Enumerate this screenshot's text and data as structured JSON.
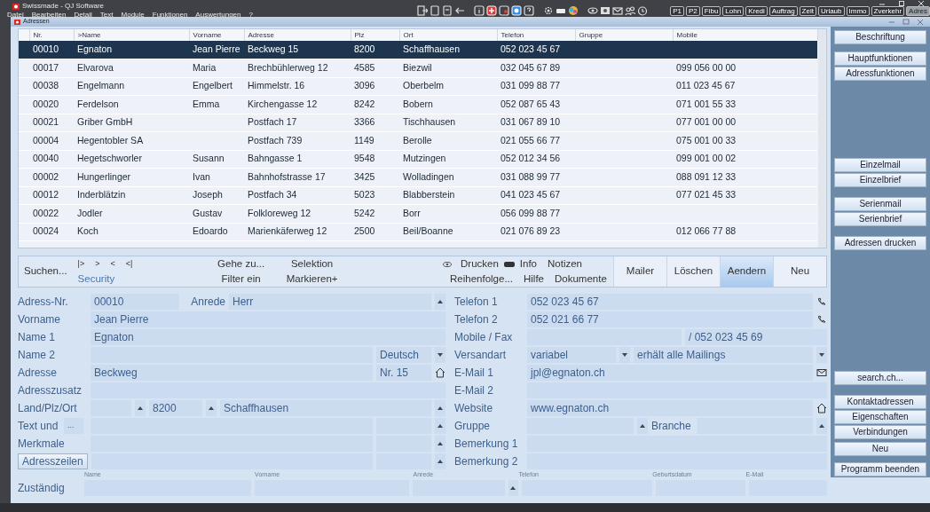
{
  "window": {
    "title": "Swissmade - QJ Software"
  },
  "menu": [
    "Datei",
    "Bearbeiten",
    "Detail",
    "Text",
    "Module",
    "Funktionen",
    "Auswertungen",
    "?"
  ],
  "modules": [
    {
      "label": "P1",
      "selected": false
    },
    {
      "label": "P2",
      "selected": false
    },
    {
      "label": "Fibu",
      "selected": false
    },
    {
      "label": "Lohn",
      "selected": false
    },
    {
      "label": "Kredi",
      "selected": false
    },
    {
      "label": "Auftrag",
      "selected": false
    },
    {
      "label": "Zeit",
      "selected": false
    },
    {
      "label": "Urlaub",
      "selected": false
    },
    {
      "label": "Immo",
      "selected": false
    },
    {
      "label": "Zverkehr",
      "selected": false
    },
    {
      "label": "Adres",
      "selected": true
    }
  ],
  "child_window": {
    "title": "Adressen"
  },
  "table": {
    "columns": [
      "Nr.",
      ">Name",
      "Vorname",
      "Adresse",
      "Plz",
      "Ort",
      "Telefon",
      "Gruppe",
      "Mobile"
    ],
    "rows": [
      {
        "selected": true,
        "cells": [
          "00010",
          "Egnaton",
          "Jean Pierre",
          "Beckweg 15",
          "8200",
          "Schaffhausen",
          "052 023 45 67",
          null,
          null
        ]
      },
      {
        "selected": false,
        "cells": [
          "00017",
          "Elvarova",
          "Maria",
          "Brechbühlerweg 12",
          "4585",
          "Biezwil",
          "032 045 67 89",
          null,
          "099 056 00 00"
        ]
      },
      {
        "selected": false,
        "cells": [
          "00038",
          "Engelmann",
          "Engelbert",
          "Himmelstr. 16",
          "3096",
          "Oberbelm",
          "031 099 88 77",
          null,
          "011 023 45 67"
        ]
      },
      {
        "selected": false,
        "cells": [
          "00020",
          "Ferdelson",
          "Emma",
          "Kirchengasse 12",
          "8242",
          "Bobern",
          "052 087 65 43",
          null,
          "071 001 55 33"
        ]
      },
      {
        "selected": false,
        "cells": [
          "00021",
          "Griber GmbH",
          null,
          "Postfach 17",
          "3366",
          "Tischhausen",
          "031 067 89 10",
          null,
          "077 001 00 00"
        ]
      },
      {
        "selected": false,
        "cells": [
          "00004",
          "Hegentobler SA",
          null,
          "Postfach 739",
          "1149",
          "Berolle",
          "021 055 66 77",
          null,
          "075 001 00 33"
        ]
      },
      {
        "selected": false,
        "cells": [
          "00040",
          "Hegetschworler",
          "Susann",
          "Bahngasse 1",
          "9548",
          "Mutzingen",
          "052 012 34 56",
          null,
          "099 001 00 02"
        ]
      },
      {
        "selected": false,
        "cells": [
          "00002",
          "Hungerlinger",
          "Ivan",
          "Bahnhofstrasse 17",
          "3425",
          "Wolladingen",
          "031 088 99 77",
          null,
          "088 091 12 33"
        ]
      },
      {
        "selected": false,
        "cells": [
          "00012",
          "Inderblätzin",
          "Joseph",
          "Postfach 34",
          "5023",
          "Blabberstein",
          "041 023 45 67",
          null,
          "077 021 45 33"
        ]
      },
      {
        "selected": false,
        "cells": [
          "00022",
          "Jodler",
          "Gustav",
          "Folkloreweg 12",
          "5242",
          "Borr",
          "056 099 88 77",
          null,
          null
        ]
      },
      {
        "selected": false,
        "cells": [
          "00024",
          "Koch",
          "Edoardo",
          "Marienkäferweg 12",
          "2500",
          "Beil/Boanne",
          "021 076 89 23",
          null,
          "012 066 77 88"
        ]
      }
    ]
  },
  "side_buttons": [
    [
      "Beschriftung"
    ],
    [
      "Hauptfunktionen",
      "Adressfunktionen"
    ],
    [
      "Einzelmail",
      "Einzelbrief"
    ],
    [
      "Serienmail",
      "Serienbrief"
    ],
    [
      "Adressen drucken"
    ],
    [
      "search.ch..."
    ],
    [
      "Kontaktadressen",
      "Eigenschaften",
      "Verbindungen"
    ],
    [
      "Neu"
    ],
    [
      "Programm beenden"
    ]
  ],
  "toolbar": {
    "search": "Suchen...",
    "nav": [
      "|>",
      ">",
      "<",
      "<|"
    ],
    "security": "Security",
    "goto": "Gehe zu...",
    "filter": "Filter ein",
    "selection": "Selektion",
    "mark": "Markieren+",
    "print": "Drucken",
    "info": "Info",
    "notes": "Notizen",
    "order": "Reihenfolge...",
    "help": "Hilfe",
    "documents": "Dokumente",
    "actions": [
      {
        "label": "Mailer",
        "selected": false
      },
      {
        "label": "Löschen",
        "selected": false
      },
      {
        "label": "Aendern",
        "selected": true
      },
      {
        "label": "Neu",
        "selected": false
      }
    ]
  },
  "form": {
    "left": [
      {
        "label": "Adress-Nr.",
        "value": "00010",
        "label2": "Anrede",
        "value2": "Herr"
      },
      {
        "label": "Vorname",
        "value": "Jean Pierre"
      },
      {
        "label": "Name 1",
        "value": "Egnaton"
      },
      {
        "label": "Name 2",
        "value2": "Deutsch"
      },
      {
        "label": "Adresse",
        "value": "Beckweg",
        "value2": "Nr. 15"
      },
      {
        "label": "Adresszusatz"
      },
      {
        "label": "Land/Plz/Ort",
        "value2": "8200",
        "value3": "Schaffhausen"
      },
      {
        "label": "Text und",
        "button": "..."
      },
      {
        "label": "Merkmale"
      }
    ],
    "address_lines_button": "Adresszeilen",
    "right": [
      {
        "label": "Telefon 1",
        "value": "052 023 45 67"
      },
      {
        "label": "Telefon 2",
        "value": "052 021 66 77"
      },
      {
        "label": "Mobile / Fax",
        "value2": "/ 052 023 45 69"
      },
      {
        "label": "Versandart",
        "value": "variabel",
        "value2": "erhält alle Mailings"
      },
      {
        "label": "E-Mail 1",
        "value": "jpl@egnaton.ch"
      },
      {
        "label": "E-Mail 2"
      },
      {
        "label": "Website",
        "value": "www.egnaton.ch"
      },
      {
        "label": "Gruppe",
        "label2": "Branche"
      },
      {
        "label": "Bemerkung 1"
      },
      {
        "label": "Bemerkung 2"
      }
    ],
    "responsible": {
      "label": "Zuständig",
      "columns": [
        "Name",
        "Vorname",
        "Anrede",
        "Telefon",
        "Geburtsdatum",
        "E-Mail"
      ]
    }
  }
}
